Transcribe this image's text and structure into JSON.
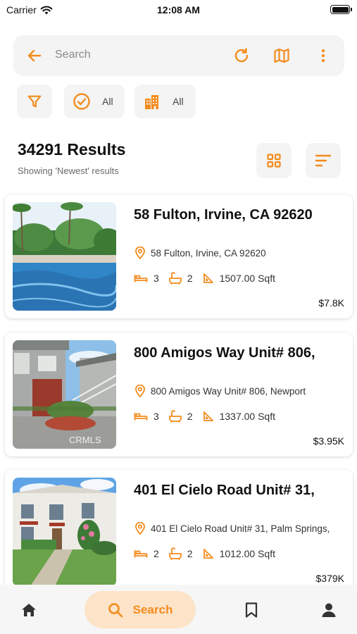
{
  "status_bar": {
    "carrier": "Carrier",
    "time": "12:08 AM"
  },
  "colors": {
    "accent": "#f38b1c",
    "chip_bg": "#f4f4f4",
    "nav_active_bg": "#fde3c8"
  },
  "search": {
    "placeholder": "Search",
    "icons": [
      "back-arrow-icon",
      "refresh-icon",
      "map-icon",
      "more-vertical-icon"
    ]
  },
  "filters": {
    "status_label": "All",
    "type_label": "All"
  },
  "results": {
    "count_text": "34291 Results",
    "subtitle": "Showing 'Newest' results"
  },
  "listings": [
    {
      "title": "58 Fulton, Irvine, CA 92620",
      "address": "58 Fulton, Irvine, CA 92620",
      "beds": "3",
      "baths": "2",
      "area": "1507.00 Sqft",
      "price": "$7.8K"
    },
    {
      "title": "800 Amigos Way Unit# 806,",
      "address": "800 Amigos Way Unit# 806, Newport",
      "beds": "3",
      "baths": "2",
      "area": "1337.00 Sqft",
      "price": "$3.95K",
      "watermark": "CRMLS"
    },
    {
      "title": "401 El Cielo Road Unit# 31,",
      "address": "401 El Cielo Road Unit# 31, Palm Springs,",
      "beds": "2",
      "baths": "2",
      "area": "1012.00 Sqft",
      "price": "$379K"
    }
  ],
  "bottom_nav": {
    "search_label": "Search",
    "active": "search"
  }
}
